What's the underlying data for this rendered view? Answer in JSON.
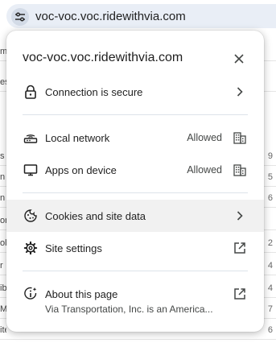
{
  "addressbar": {
    "url": "voc-voc.voc.ridewithvia.com",
    "site_info_icon": "tune-icon"
  },
  "background": {
    "left_fragments": [
      "m",
      "es",
      "n",
      "s",
      "n",
      "n",
      "on",
      "ol",
      "r",
      "ibu",
      "M",
      "ite"
    ],
    "right_fragments": [
      "9",
      "5",
      "6",
      "2",
      "4",
      "4",
      "7",
      "6"
    ]
  },
  "popup": {
    "title": "voc-voc.voc.ridewithvia.com",
    "close_icon": "close-icon",
    "connection": {
      "label": "Connection is secure",
      "icon": "lock-icon"
    },
    "permissions": [
      {
        "label": "Local network",
        "status": "Allowed",
        "icon": "router-icon"
      },
      {
        "label": "Apps on device",
        "status": "Allowed",
        "icon": "monitor-icon"
      }
    ],
    "cookies": {
      "label": "Cookies and site data",
      "icon": "cookie-icon"
    },
    "site_settings": {
      "label": "Site settings",
      "icon": "gear-icon"
    },
    "about": {
      "title": "About this page",
      "subtitle": "Via Transportation, Inc. is an America...",
      "icon": "about-icon"
    }
  },
  "colors": {
    "omnibox_bg": "#e9eef6",
    "hover_row": "#f1f1f1",
    "divider": "#dde3ea",
    "text_primary": "#1f1f1f",
    "text_secondary": "#444746"
  }
}
